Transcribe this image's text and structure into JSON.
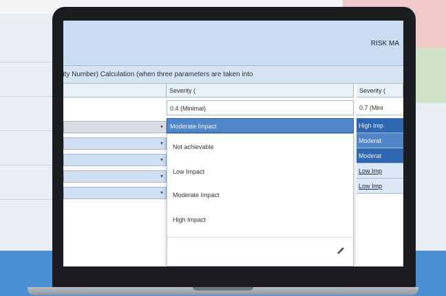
{
  "sheet": {
    "title": "RISK MA",
    "calc_bar": "rity Number) Calculation (when three parameters are taken into",
    "column_headers": [
      "Severity (",
      "Severity ("
    ],
    "row_values": {
      "mid_col_top": "0.4 (Minimal)",
      "right_col_top": "0.7 (Mini"
    }
  },
  "dropdown": {
    "selected_value": "Moderate Impact",
    "options": [
      "Not achievable",
      "Low Impact",
      "Moderate Impact",
      "High Impact"
    ]
  },
  "right_column": {
    "values": [
      "High Imp",
      "Moderat",
      "Moderat",
      "Low Imp",
      "Low Imp"
    ]
  },
  "colors": {
    "header_blue": "#c9dcf1",
    "selection_blue": "#4f87c9",
    "dark_blue": "#2f67b0",
    "laptop": "#1b1c1f"
  }
}
